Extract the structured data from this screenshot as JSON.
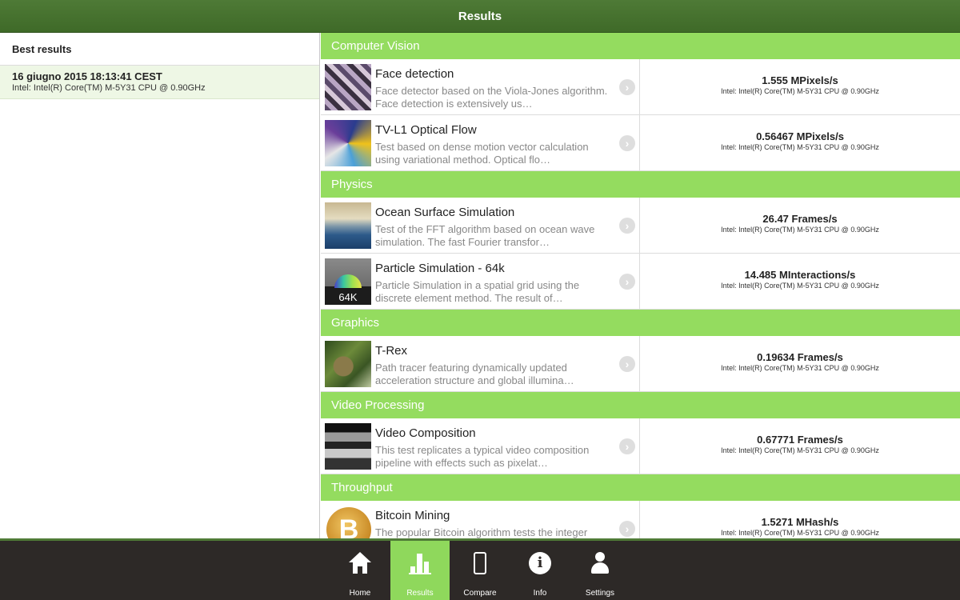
{
  "header": {
    "title": "Results"
  },
  "left_panel": {
    "title": "Best results",
    "entries": [
      {
        "date": "16 giugno 2015 18:13:41 CEST",
        "cpu": "Intel: Intel(R) Core(TM) M-5Y31 CPU @ 0.90GHz"
      }
    ]
  },
  "sections": [
    {
      "name": "Computer Vision"
    },
    {
      "name": "Physics"
    },
    {
      "name": "Graphics"
    },
    {
      "name": "Video Processing"
    },
    {
      "name": "Throughput"
    }
  ],
  "tests": [
    {
      "title": "Face detection",
      "desc": "Face detector based on the Viola-Jones algorithm. Face detection is extensively us…",
      "score": "1.555 MPixels/s",
      "cpu": "Intel: Intel(R) Core(TM) M-5Y31 CPU @ 0.90GHz",
      "icon": "face-detection-thumbnail"
    },
    {
      "title": "TV-L1 Optical Flow",
      "desc": "Test based on dense motion vector calculation using variational method. Optical flo…",
      "score": "0.56467 MPixels/s",
      "cpu": "Intel: Intel(R) Core(TM) M-5Y31 CPU @ 0.90GHz",
      "icon": "optical-flow-thumbnail"
    },
    {
      "title": "Ocean Surface Simulation",
      "desc": "Test of the FFT algorithm based on ocean wave simulation. The fast Fourier transfor…",
      "score": "26.47 Frames/s",
      "cpu": "Intel: Intel(R) Core(TM) M-5Y31 CPU @ 0.90GHz",
      "icon": "ocean-thumbnail"
    },
    {
      "title": "Particle Simulation - 64k",
      "desc": "Particle Simulation in a spatial grid using the discrete element method. The result of…",
      "score": "14.485 MInteractions/s",
      "cpu": "Intel: Intel(R) Core(TM) M-5Y31 CPU @ 0.90GHz",
      "icon": "particle-thumbnail",
      "thumb_label": "64K"
    },
    {
      "title": "T-Rex",
      "desc": "Path tracer featuring dynamically updated acceleration structure and global illumina…",
      "score": "0.19634 Frames/s",
      "cpu": "Intel: Intel(R) Core(TM) M-5Y31 CPU @ 0.90GHz",
      "icon": "trex-thumbnail"
    },
    {
      "title": "Video Composition",
      "desc": "This test replicates a typical video composition pipeline with effects such as pixelat…",
      "score": "0.67771 Frames/s",
      "cpu": "Intel: Intel(R) Core(TM) M-5Y31 CPU @ 0.90GHz",
      "icon": "video-composition-thumbnail"
    },
    {
      "title": "Bitcoin Mining",
      "desc": "The popular Bitcoin algorithm tests the integer",
      "score": "1.5271 MHash/s",
      "cpu": "Intel: Intel(R) Core(TM) M-5Y31 CPU @ 0.90GHz",
      "icon": "bitcoin-thumbnail",
      "thumb_label": "B"
    }
  ],
  "tabbar": {
    "items": [
      {
        "label": "Home",
        "icon": "home-icon"
      },
      {
        "label": "Results",
        "icon": "results-icon",
        "active": true
      },
      {
        "label": "Compare",
        "icon": "compare-icon"
      },
      {
        "label": "Info",
        "icon": "info-icon",
        "glyph": "i"
      },
      {
        "label": "Settings",
        "icon": "settings-icon"
      }
    ]
  },
  "colors": {
    "header": "#456f2e",
    "section": "#94dc5f",
    "active_tab": "#8fd85c",
    "tabbar": "#2d2927"
  }
}
